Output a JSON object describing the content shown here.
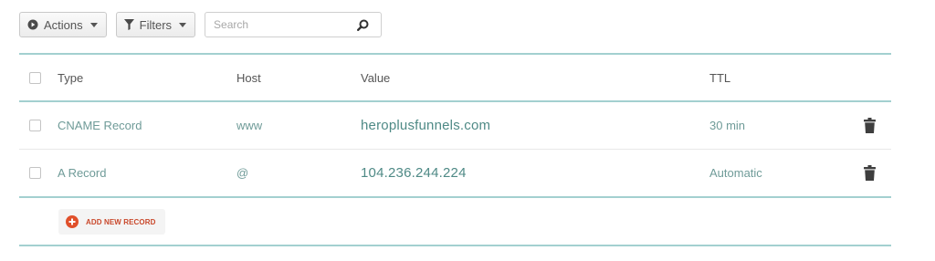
{
  "toolbar": {
    "actions_label": "Actions",
    "filters_label": "Filters",
    "search_placeholder": "Search"
  },
  "table": {
    "headers": {
      "type": "Type",
      "host": "Host",
      "value": "Value",
      "ttl": "TTL"
    },
    "rows": [
      {
        "type": "CNAME Record",
        "host": "www",
        "value": "heroplusfunnels.com",
        "ttl": "30 min"
      },
      {
        "type": "A Record",
        "host": "@",
        "value": "104.236.244.224",
        "ttl": "Automatic"
      }
    ],
    "add_label": "ADD NEW RECORD"
  },
  "icons": {
    "actions": "play-circle-icon",
    "filters": "filter-icon",
    "search": "search-icon",
    "delete": "trash-icon",
    "add": "plus-circle-icon"
  },
  "colors": {
    "accent_line": "#a3d0d0",
    "value_text": "#4f8a86",
    "add_accent": "#e0502b"
  }
}
